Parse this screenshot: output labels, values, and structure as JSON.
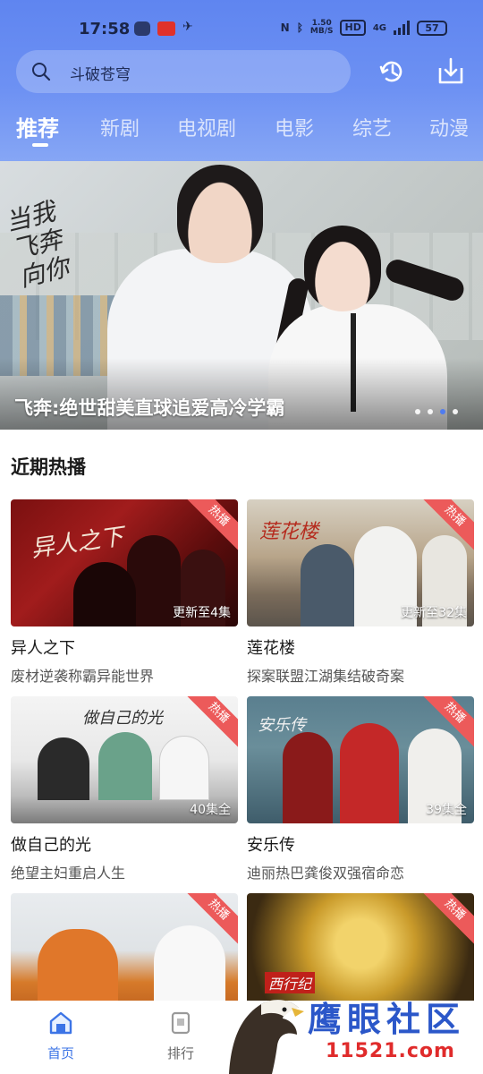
{
  "status_bar": {
    "time": "17:58",
    "speed_top": "1.50",
    "speed_bottom": "MB/S",
    "hd": "HD",
    "net": "4G",
    "battery": "57"
  },
  "search": {
    "placeholder_text": "斗破苍穹"
  },
  "tabs": [
    {
      "label": "推荐",
      "active": true
    },
    {
      "label": "新剧"
    },
    {
      "label": "电视剧"
    },
    {
      "label": "电影"
    },
    {
      "label": "综艺"
    },
    {
      "label": "动漫"
    }
  ],
  "banner": {
    "caption": "飞奔:绝世甜美直球追爱高冷学霸",
    "logo_text": "当我飞奔向你",
    "dots": 4,
    "active_dot": 2
  },
  "section": {
    "title": "近期热播"
  },
  "cards": [
    {
      "title": "异人之下",
      "subtitle": "废材逆袭称霸异能世界",
      "badge": "热播",
      "episodes": "更新至4集",
      "art_text": "异人之下"
    },
    {
      "title": "莲花楼",
      "subtitle": "探案联盟江湖集结破奇案",
      "badge": "热播",
      "episodes": "更新至32集",
      "art_text": "莲花楼"
    },
    {
      "title": "做自己的光",
      "subtitle": "绝望主妇重启人生",
      "badge": "热播",
      "episodes": "40集全",
      "art_text": "做自己的光"
    },
    {
      "title": "安乐传",
      "subtitle": "迪丽热巴龚俊双强宿命恋",
      "badge": "热播",
      "episodes": "39集全",
      "art_text": "安乐传"
    },
    {
      "title": "",
      "subtitle": "",
      "badge": "热播",
      "episodes": "",
      "art_text": ""
    },
    {
      "title": "",
      "subtitle": "",
      "badge": "热播",
      "episodes": "",
      "art_text": "西行纪"
    }
  ],
  "bottom_nav": [
    {
      "label": "首页",
      "icon": "home-icon",
      "active": true
    },
    {
      "label": "排行",
      "icon": "ranking-icon"
    }
  ],
  "watermark": {
    "text": "鹰眼社区",
    "url": "11521.com"
  },
  "colors": {
    "accent": "#3c74e6",
    "header": "#6d91f3",
    "hot": "#ec5a5a"
  }
}
